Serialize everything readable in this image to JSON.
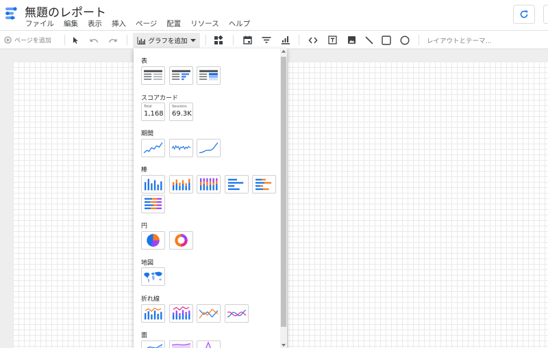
{
  "app": {
    "title": "無題のレポート",
    "menu": [
      "ファイル",
      "編集",
      "表示",
      "挿入",
      "ページ",
      "配置",
      "リソース",
      "ヘルプ"
    ]
  },
  "toolbar": {
    "add_page_label": "ページを追加",
    "add_chart_label": "グラフを追加",
    "layout_theme_label": "レイアウトとテーマ..."
  },
  "chart_menu": {
    "sections": {
      "table": "表",
      "scorecard": "スコアカード",
      "timeseries": "期間",
      "bar": "棒",
      "pie": "円",
      "geo": "地図",
      "line": "折れ線",
      "area": "面"
    },
    "scorecards": [
      {
        "label": "Total",
        "value": "1,168"
      },
      {
        "label": "Sessions",
        "value": "69.3K"
      }
    ]
  },
  "colors": {
    "accent": "#1a73e8",
    "chart_blue": "#4285f4",
    "chart_orange": "#fa7b17",
    "chart_purple": "#a142f4",
    "chart_pink": "#e52592"
  }
}
